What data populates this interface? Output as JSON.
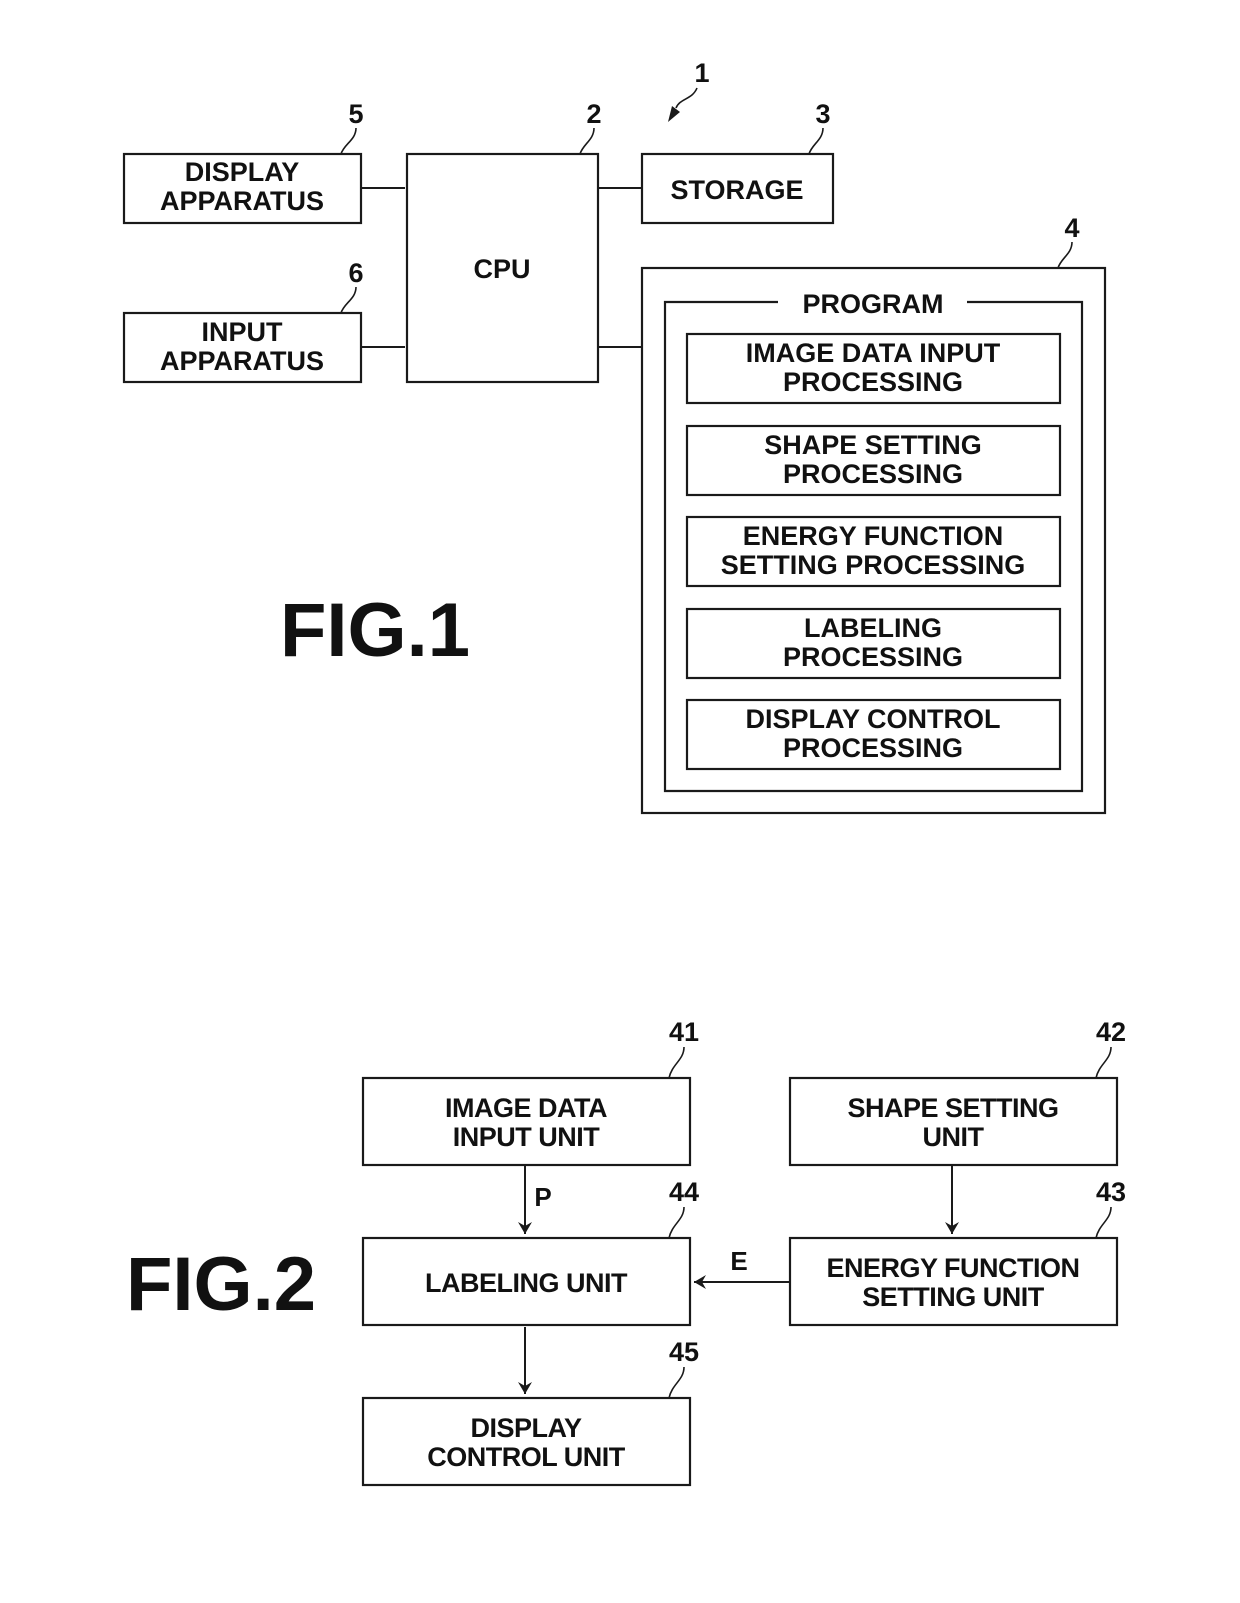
{
  "fig1": {
    "title": "FIG.1",
    "system_ref": "1",
    "blocks": {
      "display_apparatus": {
        "ref": "5",
        "lines": [
          "DISPLAY",
          "APPARATUS"
        ]
      },
      "input_apparatus": {
        "ref": "6",
        "lines": [
          "INPUT",
          "APPARATUS"
        ]
      },
      "cpu": {
        "ref": "2",
        "lines": [
          "CPU"
        ]
      },
      "storage": {
        "ref": "3",
        "lines": [
          "STORAGE"
        ]
      },
      "program_container": {
        "ref": "4",
        "title": "PROGRAM"
      }
    },
    "program_modules": [
      {
        "lines": [
          "IMAGE DATA INPUT",
          "PROCESSING"
        ]
      },
      {
        "lines": [
          "SHAPE SETTING",
          "PROCESSING"
        ]
      },
      {
        "lines": [
          "ENERGY FUNCTION",
          "SETTING PROCESSING"
        ]
      },
      {
        "lines": [
          "LABELING",
          "PROCESSING"
        ]
      },
      {
        "lines": [
          "DISPLAY CONTROL",
          "PROCESSING"
        ]
      }
    ],
    "connections": [
      [
        "display_apparatus",
        "cpu"
      ],
      [
        "input_apparatus",
        "cpu"
      ],
      [
        "cpu",
        "storage"
      ],
      [
        "cpu",
        "program_container"
      ]
    ]
  },
  "fig2": {
    "title": "FIG.2",
    "blocks": {
      "image_data_input_unit": {
        "ref": "41",
        "lines": [
          "IMAGE DATA",
          "INPUT UNIT"
        ]
      },
      "shape_setting_unit": {
        "ref": "42",
        "lines": [
          "SHAPE SETTING",
          "UNIT"
        ]
      },
      "energy_function_setting_unit": {
        "ref": "43",
        "lines": [
          "ENERGY FUNCTION",
          "SETTING UNIT"
        ]
      },
      "labeling_unit": {
        "ref": "44",
        "lines": [
          "LABELING UNIT"
        ]
      },
      "display_control_unit": {
        "ref": "45",
        "lines": [
          "DISPLAY",
          "CONTROL UNIT"
        ]
      }
    },
    "arrows": [
      {
        "from": "image_data_input_unit",
        "to": "labeling_unit",
        "signal": "P"
      },
      {
        "from": "shape_setting_unit",
        "to": "energy_function_setting_unit",
        "signal": ""
      },
      {
        "from": "energy_function_setting_unit",
        "to": "labeling_unit",
        "signal": "E"
      },
      {
        "from": "labeling_unit",
        "to": "display_control_unit",
        "signal": ""
      }
    ]
  }
}
